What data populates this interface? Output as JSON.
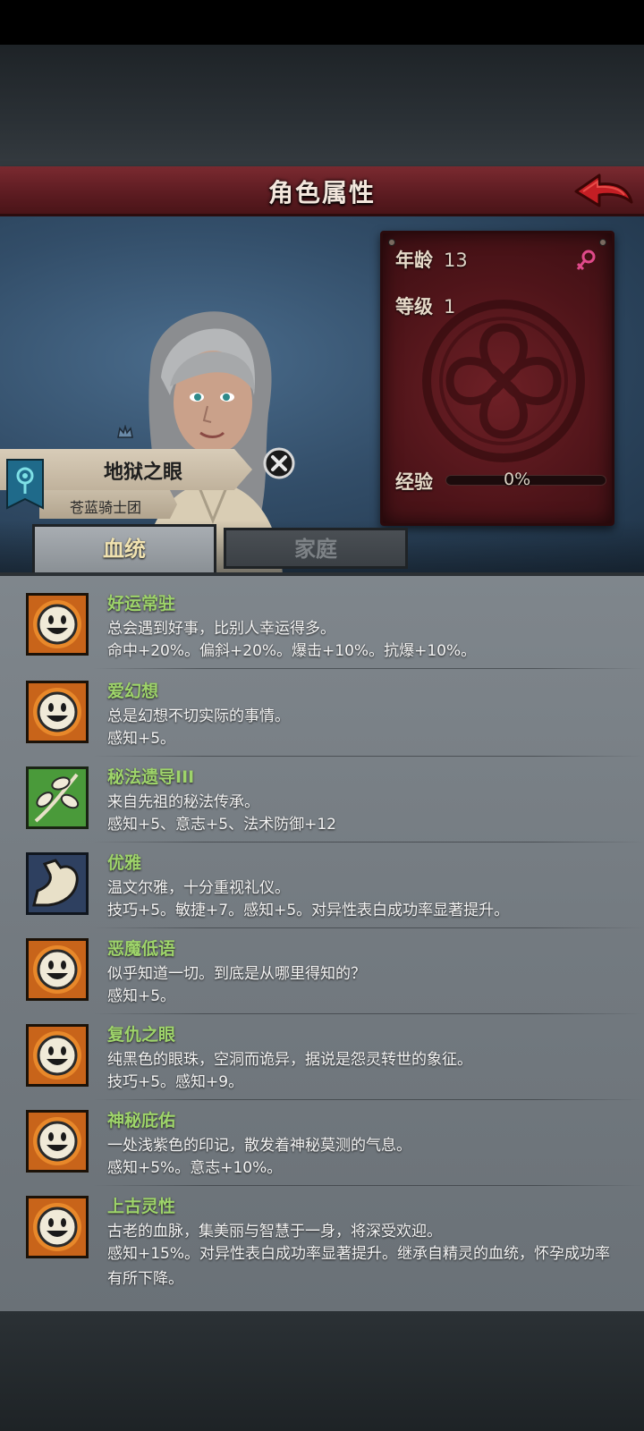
{
  "header": {
    "title": "角色属性"
  },
  "character": {
    "age_label": "年龄",
    "age_value": "13",
    "level_label": "等级",
    "level_value": "1",
    "exp_label": "经验",
    "exp_percent": "0%",
    "exp_progress": 0,
    "name": "地狱之眼",
    "guild": "苍蓝骑士团",
    "gender": "female-icon"
  },
  "tabs": [
    {
      "label": "血统",
      "active": true
    },
    {
      "label": "家庭",
      "active": false
    }
  ],
  "traits": [
    {
      "name": "好运常驻",
      "desc": "总会遇到好事，比别人幸运得多。",
      "effect": "命中+20%。偏斜+20%。爆击+10%。抗爆+10%。",
      "icon": "smiley-sun-icon"
    },
    {
      "name": "爱幻想",
      "desc": "总是幻想不切实际的事情。",
      "effect": "感知+5。",
      "icon": "smiley-sun-icon"
    },
    {
      "name": "秘法遗导III",
      "desc": "来自先祖的秘法传承。",
      "effect": "感知+5、意志+5、法术防御+12",
      "icon": "leaf-branch-icon"
    },
    {
      "name": "优雅",
      "desc": "温文尔雅，十分重视礼仪。",
      "effect": "技巧+5。敏捷+7。感知+5。对异性表白成功率显著提升。",
      "icon": "arm-muscle-icon"
    },
    {
      "name": "恶魔低语",
      "desc": "似乎知道一切。到底是从哪里得知的？",
      "effect": "感知+5。",
      "icon": "smiley-sun-icon"
    },
    {
      "name": "复仇之眼",
      "desc": "纯黑色的眼珠，空洞而诡异，据说是怨灵转世的象征。",
      "effect": "技巧+5。感知+9。",
      "icon": "smiley-sun-icon"
    },
    {
      "name": "神秘庇佑",
      "desc": "一处浅紫色的印记，散发着神秘莫测的气息。",
      "effect": "感知+5%。意志+10%。",
      "icon": "smiley-sun-icon"
    },
    {
      "name": "上古灵性",
      "desc": "古老的血脉，集美丽与智慧于一身，将深受欢迎。",
      "effect": "感知+15%。对异性表白成功率显著提升。继承自精灵的血统，怀孕成功率有所下降。",
      "icon": "smiley-sun-icon"
    }
  ],
  "colors": {
    "trait_name": "#9ed46a",
    "title_bar": "#6a2228",
    "info_panel": "#5a181d",
    "list_bg": "#787f85"
  }
}
